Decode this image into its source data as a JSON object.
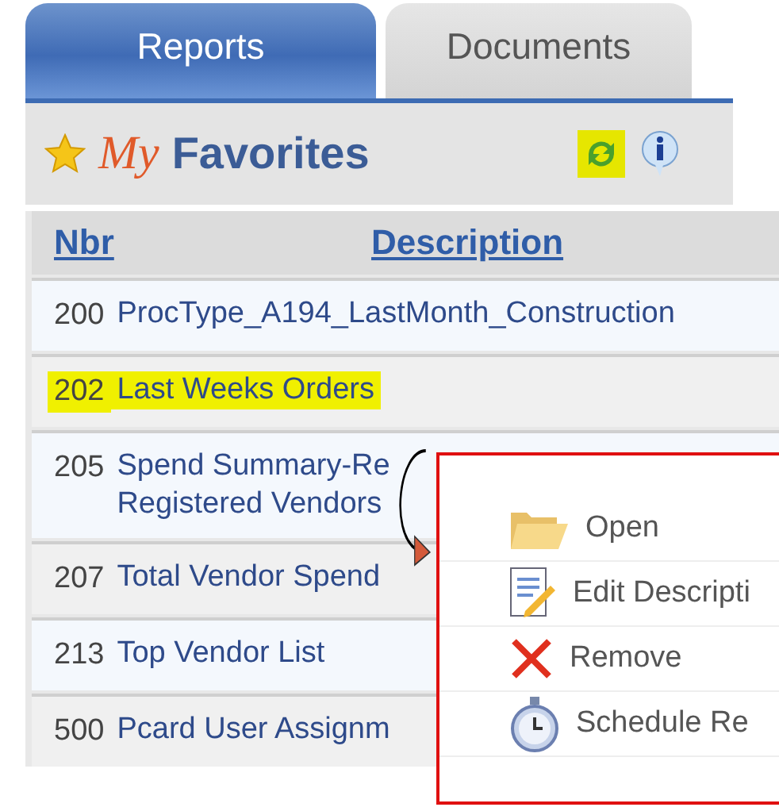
{
  "tabs": [
    {
      "label": "Reports",
      "selected": true
    },
    {
      "label": "Documents",
      "selected": false
    }
  ],
  "header": {
    "title_accent": "My",
    "title": "Favorites",
    "tools": [
      {
        "kind": "refresh",
        "highlighted": true
      },
      {
        "kind": "info",
        "highlighted": false
      }
    ]
  },
  "table": {
    "columns": [
      "Nbr",
      "Description"
    ],
    "rows": [
      {
        "nbr": "200",
        "description": "ProcType_A194_LastMonth_Construction",
        "highlighted": false
      },
      {
        "nbr": "202",
        "description": "Last Weeks Orders",
        "highlighted": true
      },
      {
        "nbr": "205",
        "description": "Spend Summary-Re\nRegistered Vendors",
        "highlighted": false
      },
      {
        "nbr": "207",
        "description": "Total Vendor Spend",
        "highlighted": false
      },
      {
        "nbr": "213",
        "description": "Top Vendor List",
        "highlighted": false
      },
      {
        "nbr": "500",
        "description": "Pcard User Assignm",
        "highlighted": false
      }
    ]
  },
  "context_menu": {
    "items": [
      {
        "kind": "open",
        "label": "Open"
      },
      {
        "kind": "edit",
        "label": "Edit Descripti"
      },
      {
        "kind": "remove",
        "label": "Remove"
      },
      {
        "kind": "schedule",
        "label": "Schedule Re"
      }
    ]
  }
}
